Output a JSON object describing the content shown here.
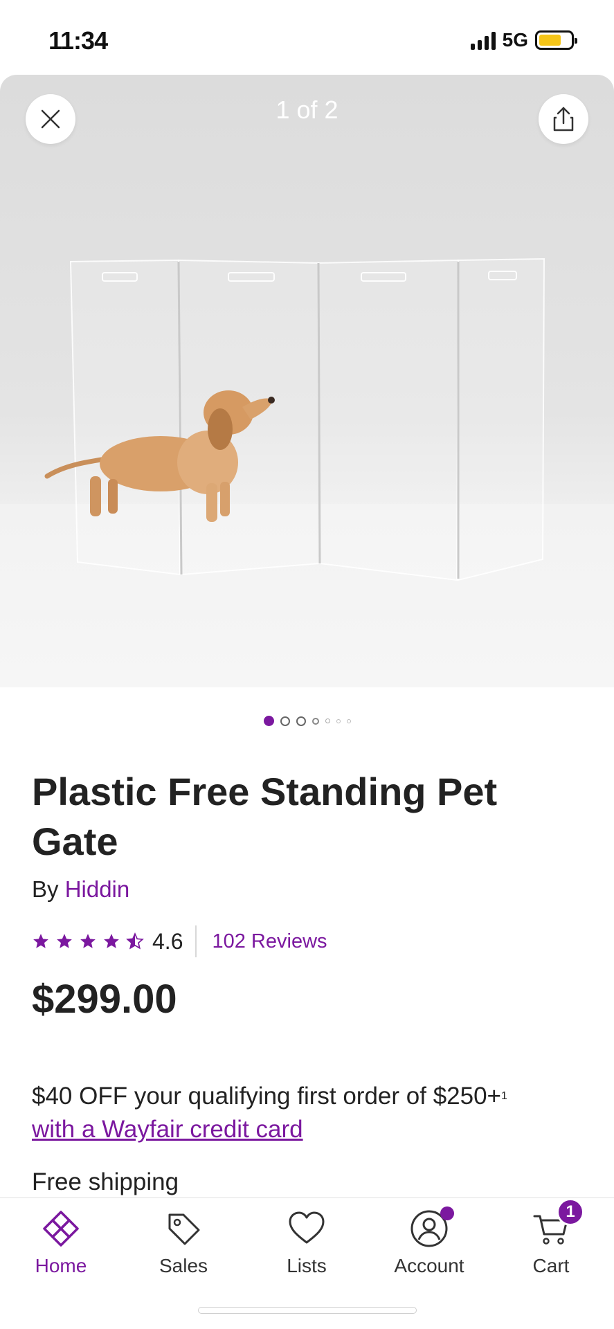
{
  "status_bar": {
    "time": "11:34",
    "network": "5G",
    "battery_level": 0.7,
    "colors": {
      "battery": "#f5c518"
    }
  },
  "gallery": {
    "counter": "1 of 2",
    "image_count": 7,
    "active_index": 0,
    "close_icon": "close-icon",
    "share_icon": "share-icon"
  },
  "product": {
    "title": "Plastic Free Standing Pet Gate",
    "by_label": "By",
    "brand": "Hiddin",
    "rating": 4.6,
    "rating_text": "4.6",
    "reviews_text": "102 Reviews",
    "price": "$299.00"
  },
  "promo": {
    "text": "$40 OFF your qualifying first order of $250+",
    "footnote": "1",
    "link_text": "with a Wayfair credit card"
  },
  "shipping": {
    "text": "Free shipping"
  },
  "bottom_nav": {
    "items": [
      {
        "label": "Home",
        "icon": "home-icon",
        "active": true
      },
      {
        "label": "Sales",
        "icon": "tag-icon",
        "active": false
      },
      {
        "label": "Lists",
        "icon": "heart-icon",
        "active": false
      },
      {
        "label": "Account",
        "icon": "account-icon",
        "active": false,
        "notification": true
      },
      {
        "label": "Cart",
        "icon": "cart-icon",
        "active": false,
        "badge": "1"
      }
    ]
  },
  "colors": {
    "accent": "#7b189f",
    "text": "#222222"
  }
}
